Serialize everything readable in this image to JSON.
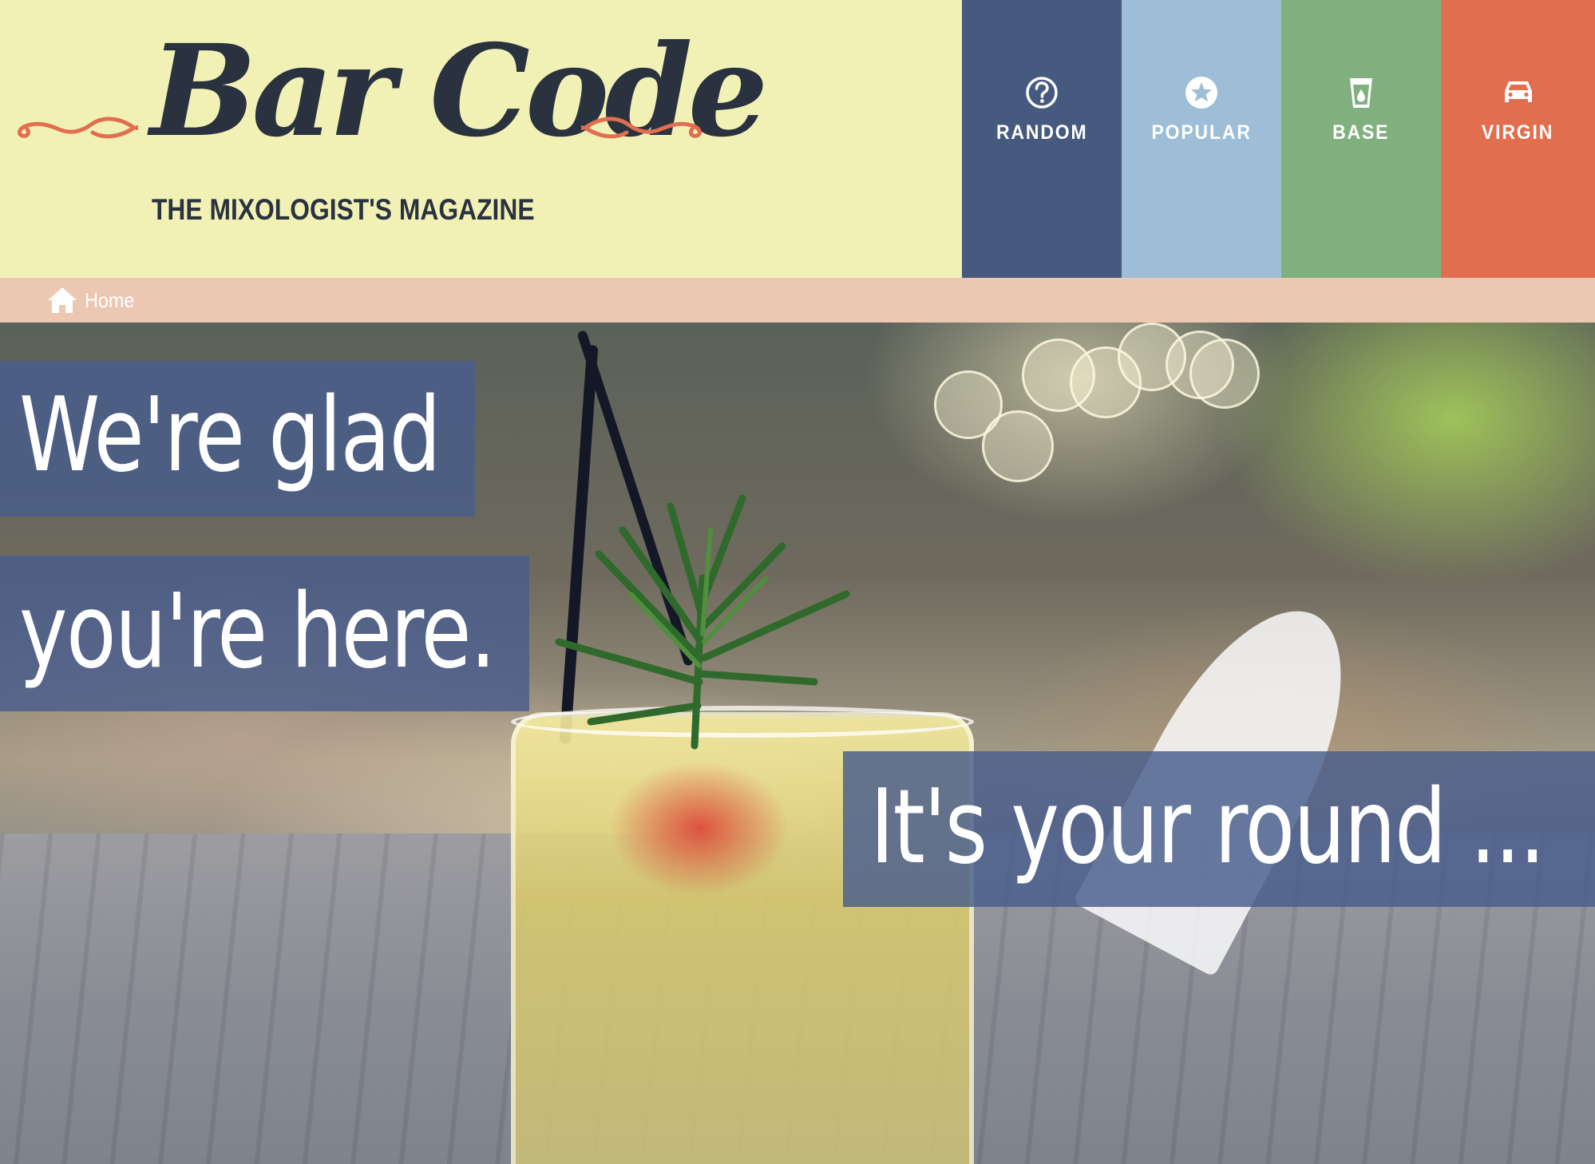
{
  "brand": {
    "title": "Bar Code",
    "tagline": "THE MIXOLOGIST'S MAGAZINE"
  },
  "nav": {
    "items": [
      {
        "label": "RANDOM",
        "icon": "question-circle-icon",
        "color": "#465a80"
      },
      {
        "label": "POPULAR",
        "icon": "star-circle-icon",
        "color": "#9dbed6"
      },
      {
        "label": "BASE",
        "icon": "glass-icon",
        "color": "#80b07e"
      },
      {
        "label": "VIRGIN",
        "icon": "car-icon",
        "color": "#e06e4f"
      }
    ]
  },
  "breadcrumb": {
    "home_label": "Home",
    "icon": "home-icon"
  },
  "hero": {
    "line1": "We're glad",
    "line2": "you're here.",
    "line3": "It's your round ..."
  },
  "colors": {
    "header_bg": "#f2f1b5",
    "breadcrumb_bg": "#ecc7b2",
    "logo_text": "#2a3240",
    "flourish": "#e06e4f",
    "hero_text_bg": "#485d8c"
  }
}
